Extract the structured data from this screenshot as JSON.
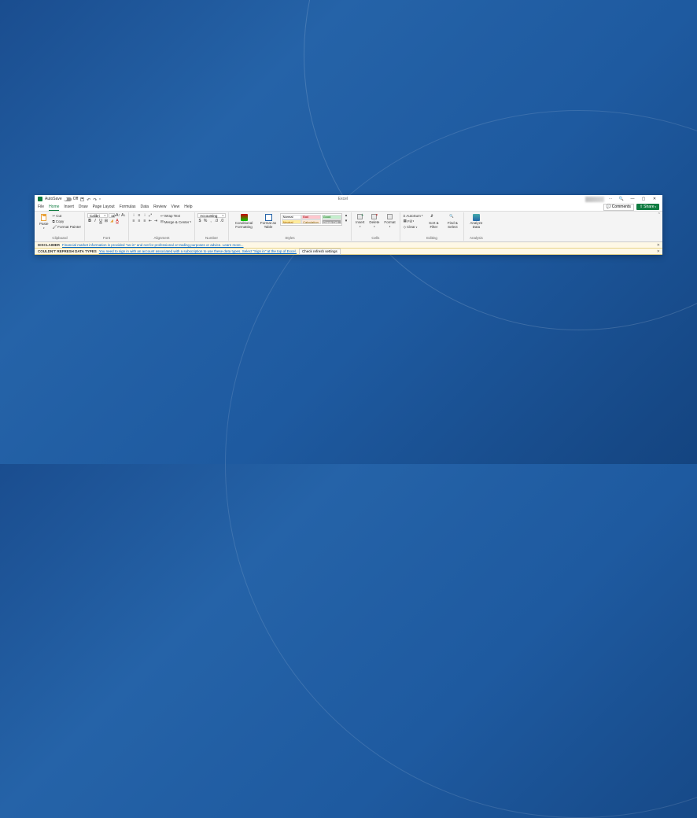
{
  "titlebar": {
    "autosave_label": "AutoSave",
    "autosave_state": "Off",
    "app_title": "Excel",
    "search_icon": "search",
    "min": "—",
    "max": "▢",
    "close": "✕"
  },
  "tabs": {
    "file": "File",
    "home": "Home",
    "insert": "Insert",
    "draw": "Draw",
    "page_layout": "Page Layout",
    "formulas": "Formulas",
    "data": "Data",
    "review": "Review",
    "view": "View",
    "help": "Help",
    "comments": "Comments",
    "share": "Share"
  },
  "ribbon": {
    "clipboard": {
      "paste": "Paste",
      "cut": "Cut",
      "copy": "Copy",
      "painter": "Format Painter",
      "label": "Clipboard"
    },
    "font": {
      "name": "Calibri",
      "size": "11",
      "label": "Font"
    },
    "align": {
      "wrap": "Wrap Text",
      "merge": "Merge & Center",
      "label": "Alignment"
    },
    "number": {
      "format": "Accounting",
      "label": "Number"
    },
    "styles": {
      "cond": "Conditional Formatting",
      "table": "Format as Table",
      "normal": "Normal",
      "bad": "Bad",
      "good": "Good",
      "neutral": "Neutral",
      "calc": "Calculation",
      "check": "Check Cell",
      "label": "Styles"
    },
    "cells": {
      "insert": "Insert",
      "delete": "Delete",
      "format": "Format",
      "label": "Cells"
    },
    "editing": {
      "autosum": "AutoSum",
      "fill": "Fill",
      "clear": "Clear",
      "sort": "Sort & Filter",
      "find": "Find & Select",
      "label": "Editing"
    },
    "analysis": {
      "analyze": "Analyze Data",
      "label": "Analysis"
    }
  },
  "bar1": {
    "title": "DISCLAIMER",
    "text": "Financial market information is provided \"as-is\" and not for professional or trading purposes or advice. Learn more..."
  },
  "bar2": {
    "title": "COULDN'T REFRESH DATA TYPES",
    "text": "You need to sign in with an account associated with a subscription to use these data types. Select \"Sign in\" at the top of Excel.",
    "button": "Check refresh settings"
  }
}
